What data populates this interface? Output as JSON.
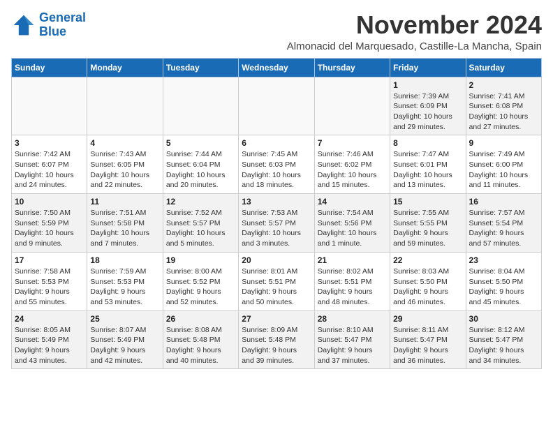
{
  "header": {
    "logo_line1": "General",
    "logo_line2": "Blue",
    "month": "November 2024",
    "location": "Almonacid del Marquesado, Castille-La Mancha, Spain"
  },
  "weekdays": [
    "Sunday",
    "Monday",
    "Tuesday",
    "Wednesday",
    "Thursday",
    "Friday",
    "Saturday"
  ],
  "weeks": [
    [
      {
        "day": "",
        "info": ""
      },
      {
        "day": "",
        "info": ""
      },
      {
        "day": "",
        "info": ""
      },
      {
        "day": "",
        "info": ""
      },
      {
        "day": "",
        "info": ""
      },
      {
        "day": "1",
        "info": "Sunrise: 7:39 AM\nSunset: 6:09 PM\nDaylight: 10 hours\nand 29 minutes."
      },
      {
        "day": "2",
        "info": "Sunrise: 7:41 AM\nSunset: 6:08 PM\nDaylight: 10 hours\nand 27 minutes."
      }
    ],
    [
      {
        "day": "3",
        "info": "Sunrise: 7:42 AM\nSunset: 6:07 PM\nDaylight: 10 hours\nand 24 minutes."
      },
      {
        "day": "4",
        "info": "Sunrise: 7:43 AM\nSunset: 6:05 PM\nDaylight: 10 hours\nand 22 minutes."
      },
      {
        "day": "5",
        "info": "Sunrise: 7:44 AM\nSunset: 6:04 PM\nDaylight: 10 hours\nand 20 minutes."
      },
      {
        "day": "6",
        "info": "Sunrise: 7:45 AM\nSunset: 6:03 PM\nDaylight: 10 hours\nand 18 minutes."
      },
      {
        "day": "7",
        "info": "Sunrise: 7:46 AM\nSunset: 6:02 PM\nDaylight: 10 hours\nand 15 minutes."
      },
      {
        "day": "8",
        "info": "Sunrise: 7:47 AM\nSunset: 6:01 PM\nDaylight: 10 hours\nand 13 minutes."
      },
      {
        "day": "9",
        "info": "Sunrise: 7:49 AM\nSunset: 6:00 PM\nDaylight: 10 hours\nand 11 minutes."
      }
    ],
    [
      {
        "day": "10",
        "info": "Sunrise: 7:50 AM\nSunset: 5:59 PM\nDaylight: 10 hours\nand 9 minutes."
      },
      {
        "day": "11",
        "info": "Sunrise: 7:51 AM\nSunset: 5:58 PM\nDaylight: 10 hours\nand 7 minutes."
      },
      {
        "day": "12",
        "info": "Sunrise: 7:52 AM\nSunset: 5:57 PM\nDaylight: 10 hours\nand 5 minutes."
      },
      {
        "day": "13",
        "info": "Sunrise: 7:53 AM\nSunset: 5:57 PM\nDaylight: 10 hours\nand 3 minutes."
      },
      {
        "day": "14",
        "info": "Sunrise: 7:54 AM\nSunset: 5:56 PM\nDaylight: 10 hours\nand 1 minute."
      },
      {
        "day": "15",
        "info": "Sunrise: 7:55 AM\nSunset: 5:55 PM\nDaylight: 9 hours\nand 59 minutes."
      },
      {
        "day": "16",
        "info": "Sunrise: 7:57 AM\nSunset: 5:54 PM\nDaylight: 9 hours\nand 57 minutes."
      }
    ],
    [
      {
        "day": "17",
        "info": "Sunrise: 7:58 AM\nSunset: 5:53 PM\nDaylight: 9 hours\nand 55 minutes."
      },
      {
        "day": "18",
        "info": "Sunrise: 7:59 AM\nSunset: 5:53 PM\nDaylight: 9 hours\nand 53 minutes."
      },
      {
        "day": "19",
        "info": "Sunrise: 8:00 AM\nSunset: 5:52 PM\nDaylight: 9 hours\nand 52 minutes."
      },
      {
        "day": "20",
        "info": "Sunrise: 8:01 AM\nSunset: 5:51 PM\nDaylight: 9 hours\nand 50 minutes."
      },
      {
        "day": "21",
        "info": "Sunrise: 8:02 AM\nSunset: 5:51 PM\nDaylight: 9 hours\nand 48 minutes."
      },
      {
        "day": "22",
        "info": "Sunrise: 8:03 AM\nSunset: 5:50 PM\nDaylight: 9 hours\nand 46 minutes."
      },
      {
        "day": "23",
        "info": "Sunrise: 8:04 AM\nSunset: 5:50 PM\nDaylight: 9 hours\nand 45 minutes."
      }
    ],
    [
      {
        "day": "24",
        "info": "Sunrise: 8:05 AM\nSunset: 5:49 PM\nDaylight: 9 hours\nand 43 minutes."
      },
      {
        "day": "25",
        "info": "Sunrise: 8:07 AM\nSunset: 5:49 PM\nDaylight: 9 hours\nand 42 minutes."
      },
      {
        "day": "26",
        "info": "Sunrise: 8:08 AM\nSunset: 5:48 PM\nDaylight: 9 hours\nand 40 minutes."
      },
      {
        "day": "27",
        "info": "Sunrise: 8:09 AM\nSunset: 5:48 PM\nDaylight: 9 hours\nand 39 minutes."
      },
      {
        "day": "28",
        "info": "Sunrise: 8:10 AM\nSunset: 5:47 PM\nDaylight: 9 hours\nand 37 minutes."
      },
      {
        "day": "29",
        "info": "Sunrise: 8:11 AM\nSunset: 5:47 PM\nDaylight: 9 hours\nand 36 minutes."
      },
      {
        "day": "30",
        "info": "Sunrise: 8:12 AM\nSunset: 5:47 PM\nDaylight: 9 hours\nand 34 minutes."
      }
    ]
  ]
}
